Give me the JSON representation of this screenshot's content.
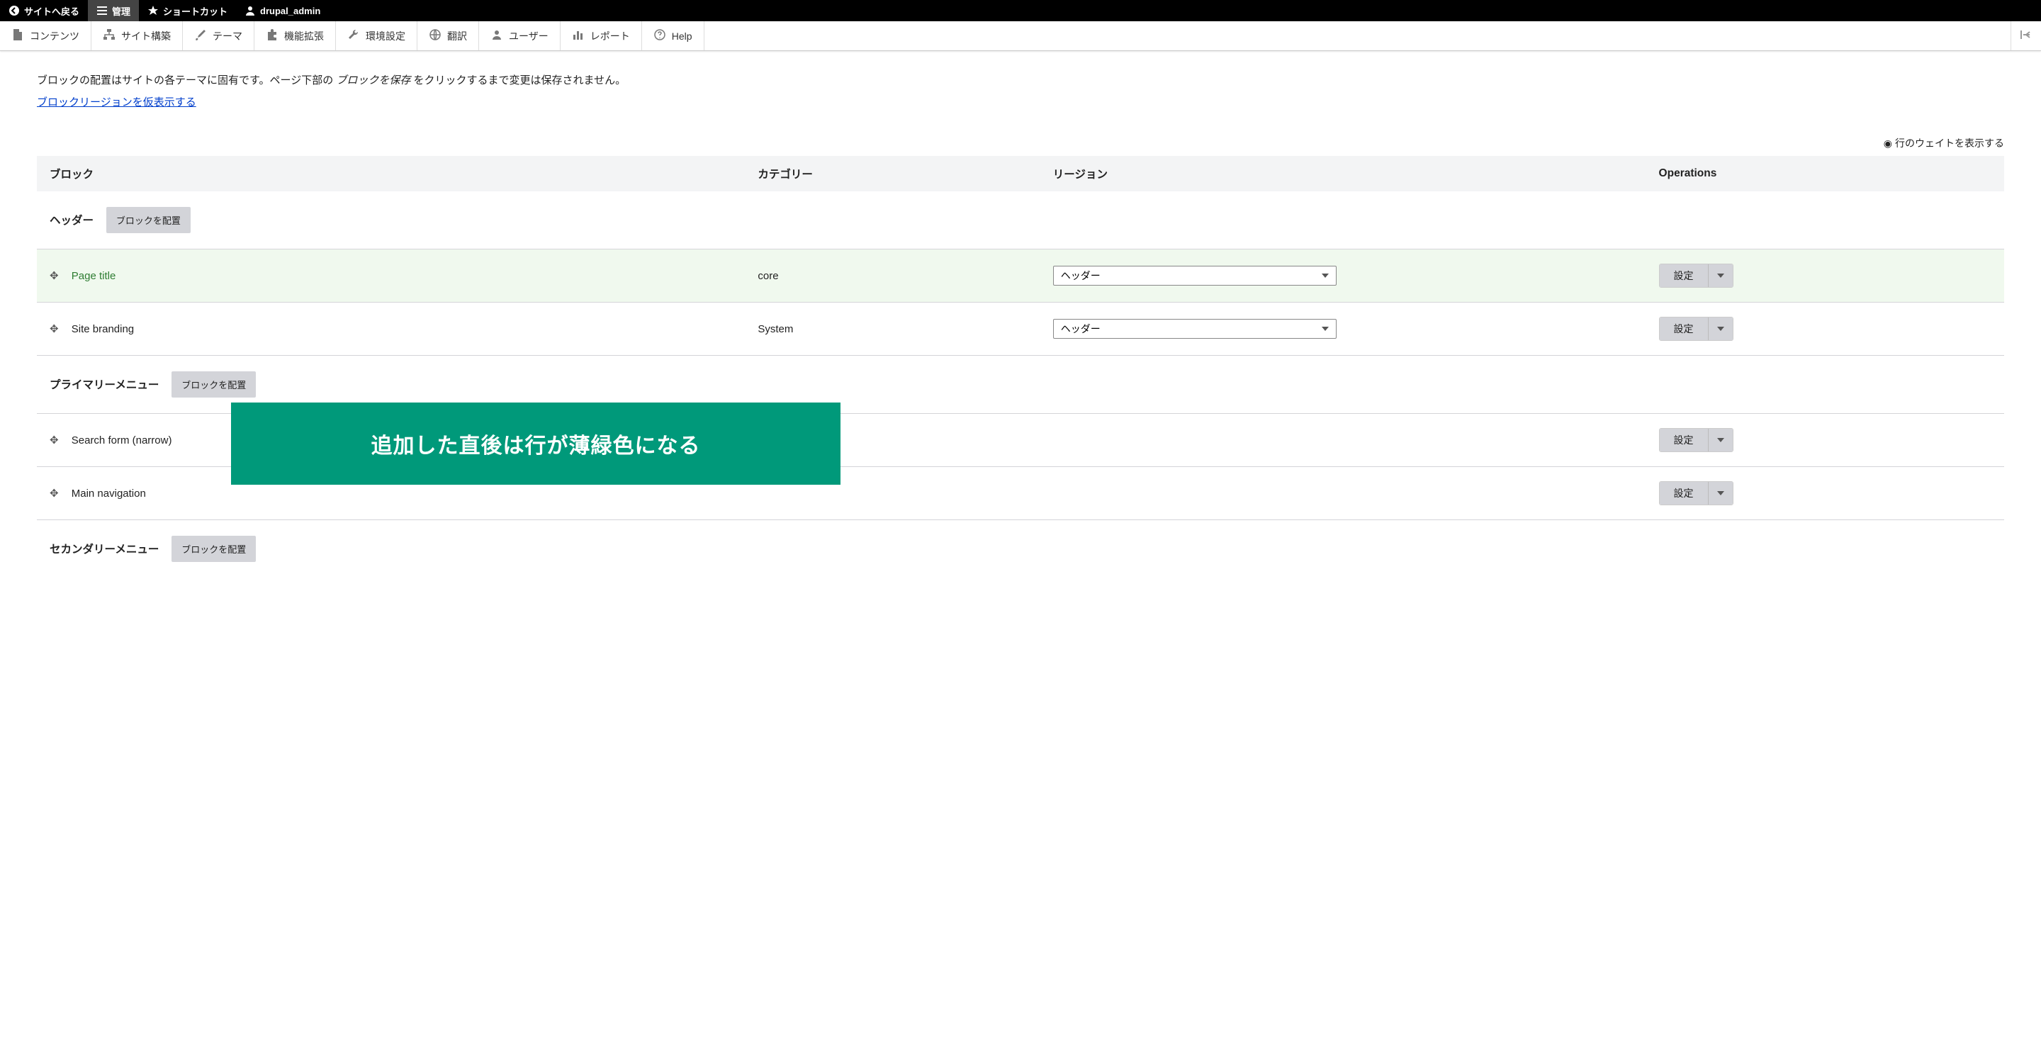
{
  "top_bar": {
    "back_to_site": "サイトへ戻る",
    "manage": "管理",
    "shortcuts": "ショートカット",
    "user": "drupal_admin"
  },
  "admin_menu": {
    "content": "コンテンツ",
    "structure": "サイト構築",
    "appearance": "テーマ",
    "extend": "機能拡張",
    "config": "環境設定",
    "translate": "翻訳",
    "people": "ユーザー",
    "reports": "レポート",
    "help": "Help"
  },
  "description": {
    "part1": "ブロックの配置はサイトの各テーマに固有です。ページ下部の",
    "italic": " ブロックを保存 ",
    "part2": "をクリックするまで変更は保存されません。"
  },
  "demo_link": "ブロックリージョンを仮表示する",
  "weights_toggle": "行のウェイトを表示する",
  "table_headers": {
    "block": "ブロック",
    "category": "カテゴリー",
    "region": "リージョン",
    "operations": "Operations"
  },
  "regions": {
    "header": {
      "label": "ヘッダー",
      "place_button": "ブロックを配置"
    },
    "primary_menu": {
      "label": "プライマリーメニュー",
      "place_button": "ブロックを配置"
    },
    "secondary_menu": {
      "label": "セカンダリーメニュー",
      "place_button": "ブロックを配置"
    }
  },
  "blocks": {
    "page_title": {
      "name": "Page title",
      "category": "core",
      "region": "ヘッダー",
      "op": "設定"
    },
    "site_branding": {
      "name": "Site branding",
      "category": "System",
      "region": "ヘッダー",
      "op": "設定"
    },
    "search_narrow": {
      "name": "Search form (narrow)",
      "category": "",
      "region": "",
      "op": "設定"
    },
    "main_nav": {
      "name": "Main navigation",
      "category": "",
      "region": "",
      "op": "設定"
    }
  },
  "annotation": "追加した直後は行が薄緑色になる"
}
